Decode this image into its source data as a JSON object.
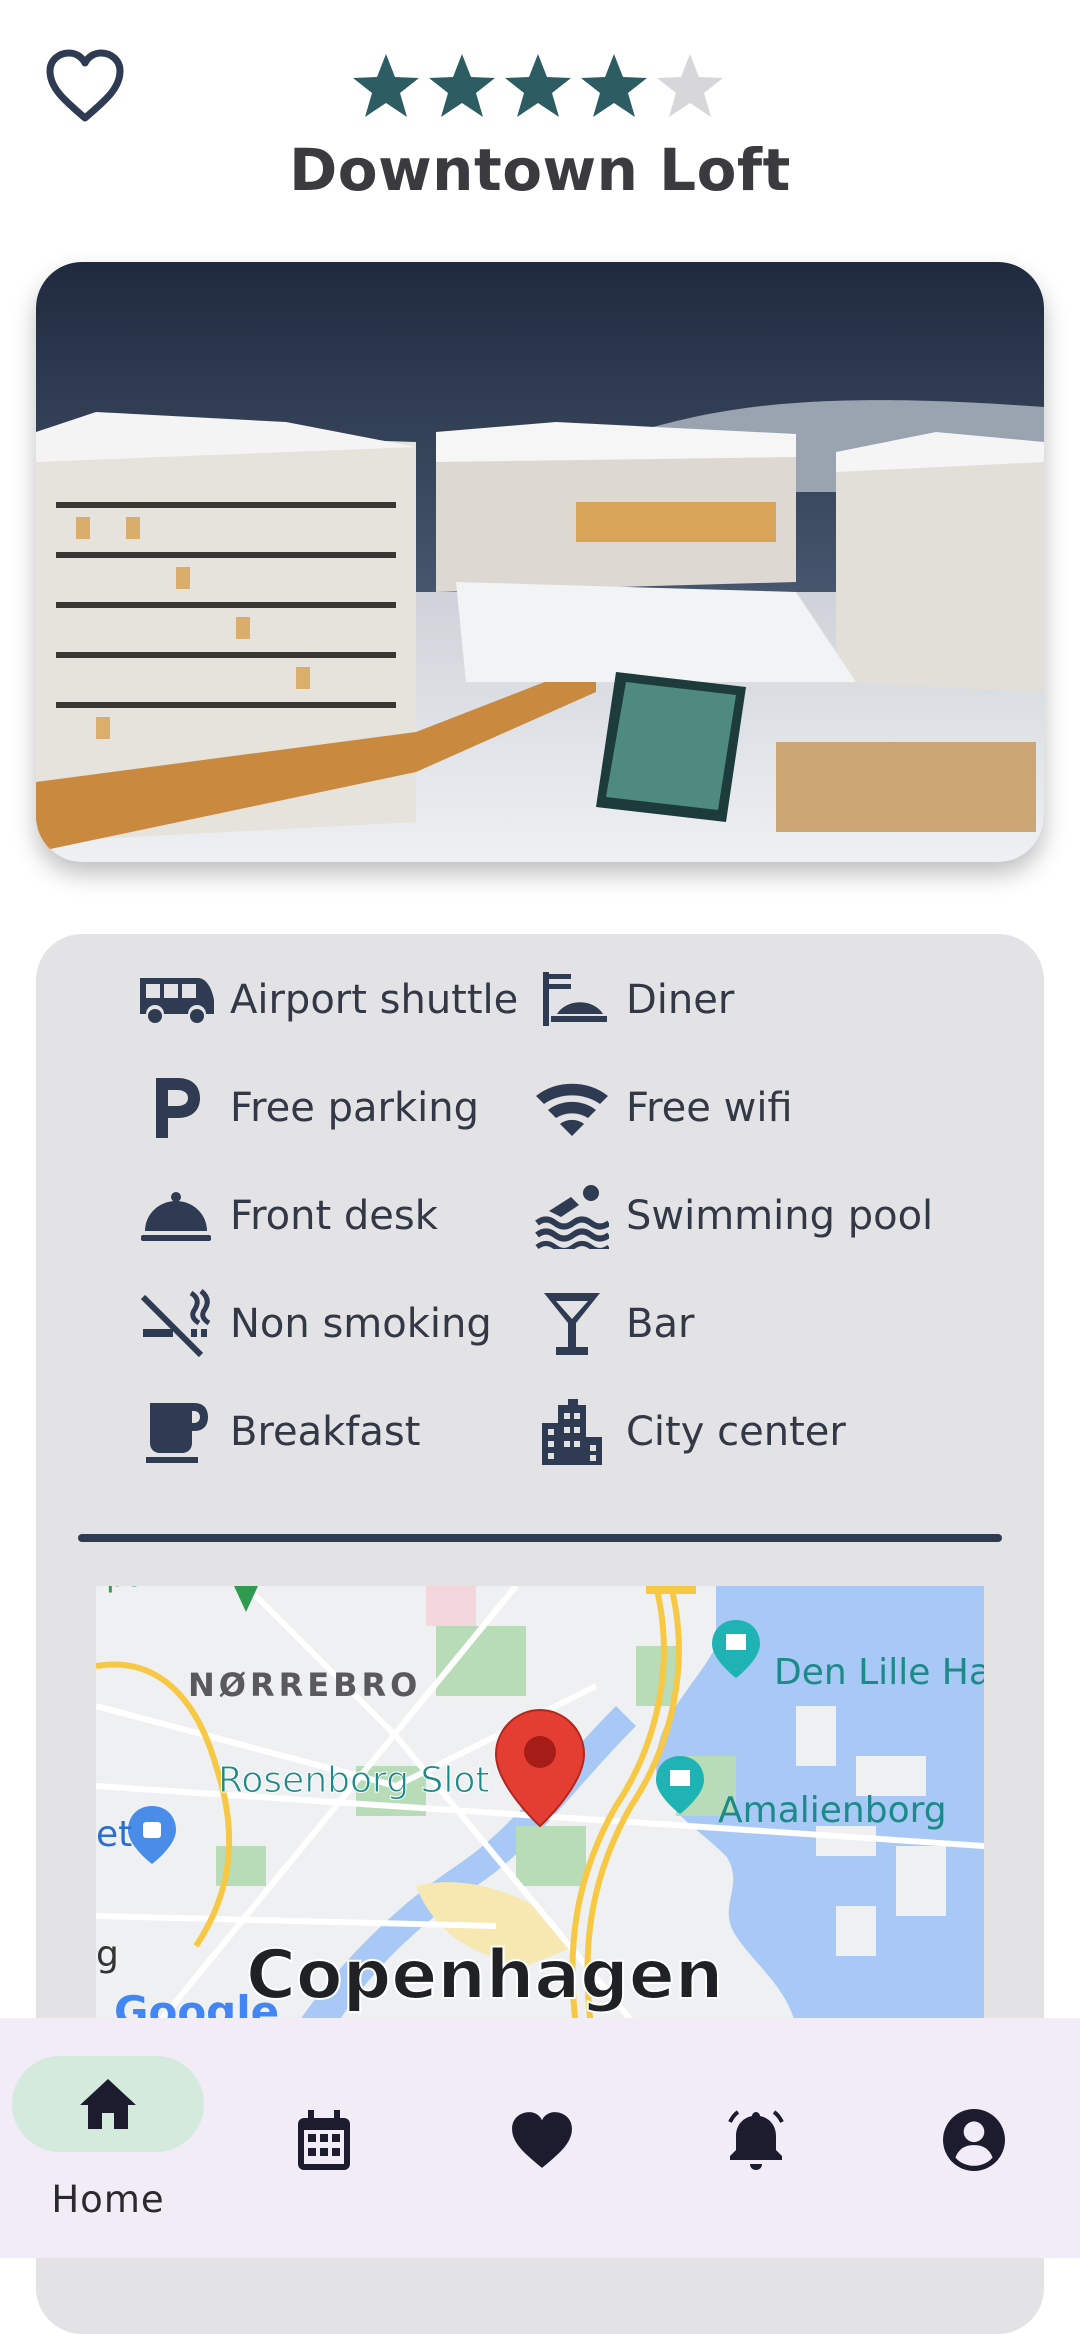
{
  "header": {
    "title": "Downtown Loft",
    "rating": 4,
    "rating_max": 5,
    "favorite_icon": "heart-outline-icon"
  },
  "colors": {
    "star_filled": "#2d5d62",
    "star_empty": "#d7d7d9",
    "card_bg": "#e3e3e5",
    "icon": "#2e3b52",
    "nav_bg": "#f1ecf6",
    "nav_active_pill": "#d4eadd"
  },
  "amenities": [
    {
      "label": "Airport shuttle",
      "icon": "shuttle-icon"
    },
    {
      "label": "Diner",
      "icon": "dining-icon"
    },
    {
      "label": "Free parking",
      "icon": "parking-icon"
    },
    {
      "label": "Free wifi",
      "icon": "wifi-icon"
    },
    {
      "label": "Front desk",
      "icon": "front-desk-icon"
    },
    {
      "label": "Swimming pool",
      "icon": "pool-icon"
    },
    {
      "label": "Non smoking",
      "icon": "no-smoking-icon"
    },
    {
      "label": "Bar",
      "icon": "bar-icon"
    },
    {
      "label": "Breakfast",
      "icon": "coffee-icon"
    },
    {
      "label": "City center",
      "icon": "city-icon"
    }
  ],
  "map": {
    "labels": {
      "district": "NØRREBRO",
      "poi_1": "Rosenborg Slot",
      "poi_2": "Amalienborg",
      "poi_3": "Den Lille Ha",
      "city": "Copenhagen",
      "edge_left_1": "et",
      "edge_left_2": "g",
      "edge_top": "park",
      "attribution": "Google"
    }
  },
  "bottom_nav": {
    "items": [
      {
        "label": "Home",
        "icon": "home-icon",
        "active": true
      },
      {
        "icon": "calendar-icon"
      },
      {
        "icon": "favorites-heart-icon"
      },
      {
        "icon": "notifications-bell-icon"
      },
      {
        "icon": "account-icon"
      }
    ]
  }
}
